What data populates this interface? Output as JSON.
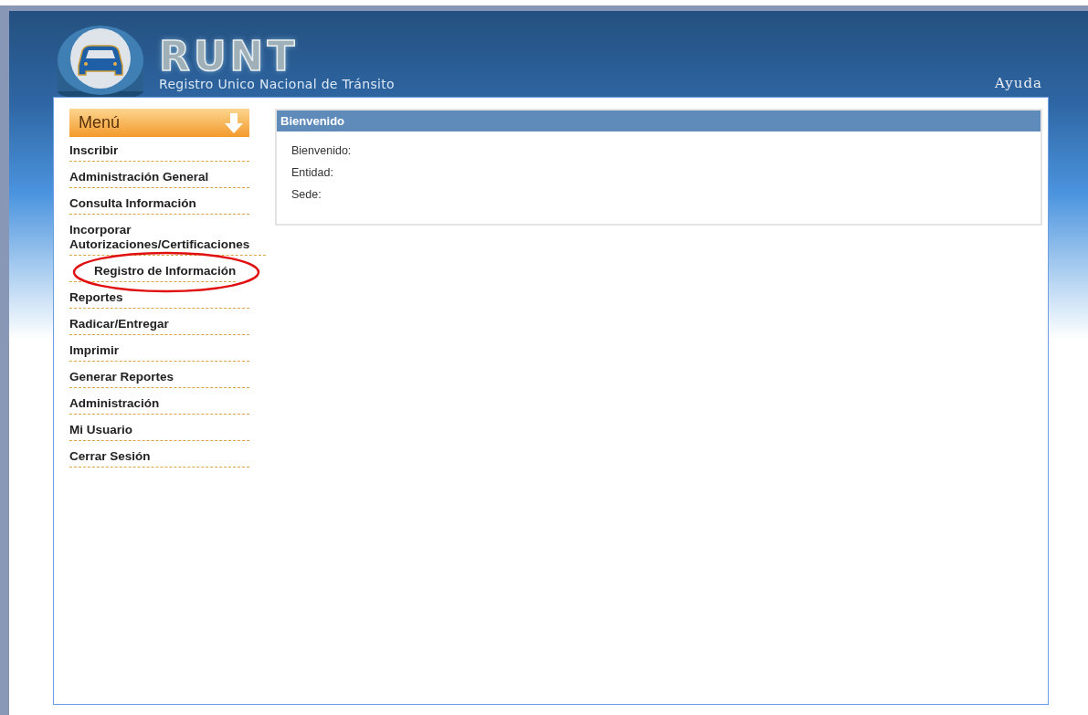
{
  "header": {
    "logo_text": "RUNT",
    "subtitle": "Registro Unico Nacional de Tránsito",
    "help_link": "Ayuda"
  },
  "menu": {
    "title": "Menú",
    "items": [
      {
        "label": "Inscribir"
      },
      {
        "label": "Administración General"
      },
      {
        "label": "Consulta Información"
      },
      {
        "label": "Incorporar Autorizaciones/Certificaciones",
        "children": [
          {
            "label": "Registro de Información",
            "highlighted": true
          }
        ]
      },
      {
        "label": "Reportes"
      },
      {
        "label": "Radicar/Entregar"
      },
      {
        "label": "Imprimir"
      },
      {
        "label": "Generar Reportes"
      },
      {
        "label": "Administración"
      },
      {
        "label": "Mi Usuario"
      },
      {
        "label": "Cerrar Sesión"
      }
    ]
  },
  "welcome_panel": {
    "title": "Bienvenido",
    "fields": [
      "Bienvenido:",
      "Entidad:",
      "Sede:"
    ]
  }
}
